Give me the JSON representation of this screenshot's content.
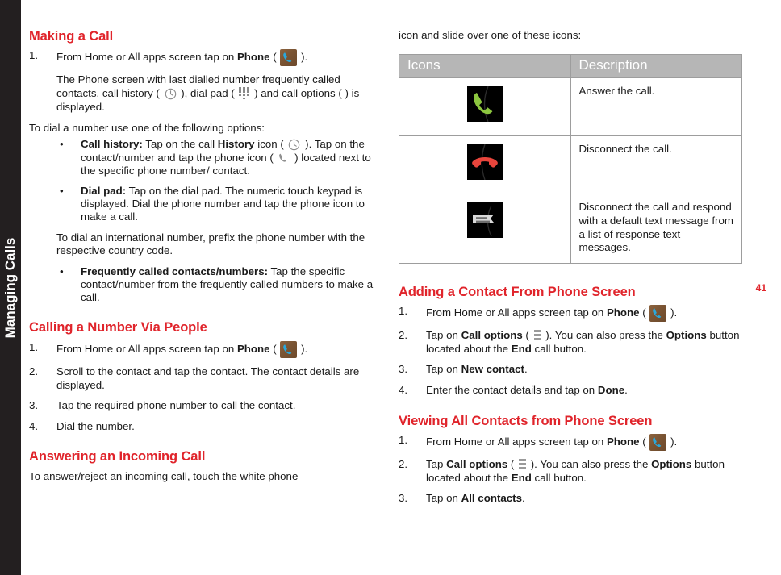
{
  "chapter_tab": {
    "label": "Managing Calls"
  },
  "page_number": "41",
  "left_column": {
    "heading_making_a_call": "Making a Call",
    "step1_num": "1.",
    "step1_pre": "From Home or All apps screen tap on ",
    "step1_bold": "Phone",
    "step1_open": " ( ",
    "step1_close": " ).",
    "phone_screen_p1": "The Phone screen with last dialled number frequently called contacts, call history ( ",
    "phone_screen_p2": " ), dial pad ( ",
    "phone_screen_p3": " ) and call options ( ) is displayed.",
    "to_dial_line": "To dial a number use one of the following options:",
    "bullet_dot": "•",
    "b1_label": "Call history:",
    "b1_t1": " Tap on the call ",
    "b1_bold": "History",
    "b1_t2": " icon ( ",
    "b1_t3": " ). Tap on the contact/number and tap the phone icon ( ",
    "b1_t4": " ) located next to the specific phone number/ contact.",
    "b2_label": "Dial pad:",
    "b2_text": " Tap on the dial pad. The numeric touch keypad is displayed. Dial the phone number and tap the phone icon to make a call.",
    "intl_text": "To dial an international number, prefix the phone number with the respective country code.",
    "b3_label": "Frequently called contacts/numbers:",
    "b3_text": " Tap the specific contact/number from the frequently called numbers to make a call.",
    "heading_calling_via_people": "Calling a Number Via People",
    "cp_step1_num": "1.",
    "cp_step1_pre": "From Home or All apps screen tap on ",
    "cp_step1_bold": "Phone",
    "cp_step1_open": " ( ",
    "cp_step1_close": " ).",
    "cp_step2_num": "2.",
    "cp_step2_text": "Scroll to the contact and tap the contact. The contact details are displayed.",
    "cp_step3_num": "3.",
    "cp_step3_text": "Tap the required phone number to call the contact.",
    "cp_step4_num": "4.",
    "cp_step4_text": "Dial the number.",
    "heading_answering": "Answering an Incoming Call",
    "answering_text": "To answer/reject an incoming call, touch the white phone"
  },
  "right_column": {
    "continuation_text": "icon and slide over one of these icons:",
    "table": {
      "headers": [
        "Icons",
        "Description"
      ],
      "rows": [
        {
          "icon": "answer-call-icon",
          "description": "Answer the call."
        },
        {
          "icon": "disconnect-call-icon",
          "description": "Disconnect the call."
        },
        {
          "icon": "reject-with-message-icon",
          "description": "Disconnect the call and respond with a default text message from a list of response text messages."
        }
      ]
    },
    "heading_adding_contact": "Adding a Contact From Phone Screen",
    "ac_step1_num": "1.",
    "ac_step1_pre": "From Home or All apps screen tap on ",
    "ac_step1_bold": "Phone",
    "ac_step1_open": " ( ",
    "ac_step1_close": " ).",
    "ac_step2_num": "2.",
    "ac_step2_t1": "Tap on ",
    "ac_step2_bold1": "Call options",
    "ac_step2_t2": " ( ",
    "ac_step2_t3": " ). You can also press the ",
    "ac_step2_bold2": "Options",
    "ac_step2_t4": " button located about the ",
    "ac_step2_bold3": "End",
    "ac_step2_t5": " call button.",
    "ac_step3_num": "3.",
    "ac_step3_t1": "Tap on ",
    "ac_step3_bold": "New contact",
    "ac_step3_t2": ".",
    "ac_step4_num": "4.",
    "ac_step4_t1": "Enter the contact details and tap on ",
    "ac_step4_bold": "Done",
    "ac_step4_t2": ".",
    "heading_viewing_contacts": "Viewing All Contacts from Phone Screen",
    "vc_step1_num": "1.",
    "vc_step1_pre": "From Home or All apps screen tap on ",
    "vc_step1_bold": "Phone",
    "vc_step1_open": " ( ",
    "vc_step1_close": " ).",
    "vc_step2_num": "2.",
    "vc_step2_t1": "Tap ",
    "vc_step2_bold1": "Call options",
    "vc_step2_t2": " ( ",
    "vc_step2_t3": " ). You can also press the ",
    "vc_step2_bold2": "Options",
    "vc_step2_t4": " button located about the ",
    "vc_step2_bold3": "End",
    "vc_step2_t5": " call button.",
    "vc_step3_num": "3.",
    "vc_step3_t1": "Tap on ",
    "vc_step3_bold": "All contacts",
    "vc_step3_t2": "."
  },
  "colors": {
    "heading_red": "#e0242b",
    "tab_dark": "#231f20",
    "table_header_gray": "#b6b6b6",
    "table_border": "#9d9d9d",
    "answer_green": "#8cc63f",
    "disconnect_red": "#e8453c",
    "message_gray": "#d6d6d6",
    "phone_tile_brown": "#7a5433",
    "phone_handset_cyan": "#29a8dd"
  }
}
